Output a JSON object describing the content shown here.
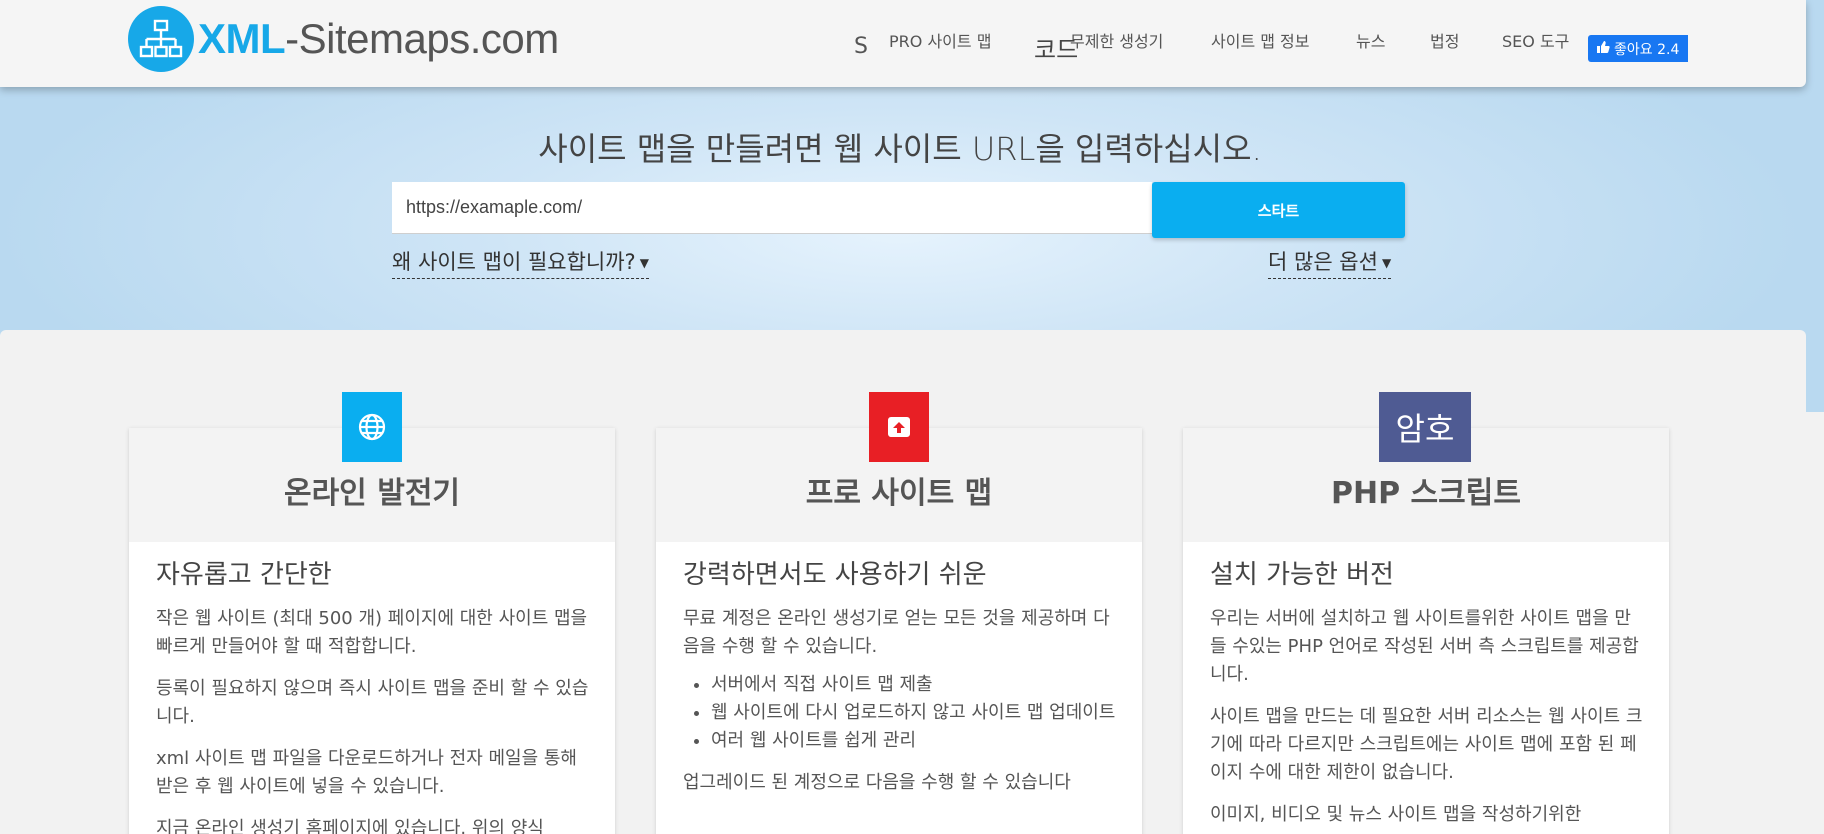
{
  "header": {
    "logo_xml": "XML",
    "logo_rest": "-Sitemaps.com",
    "nav_s": "S",
    "nav_code": "코드",
    "nav_items": [
      {
        "label": "PRO 사이트 맵"
      },
      {
        "label": "무제한 생성기"
      },
      {
        "label": "사이트 맵 정보"
      },
      {
        "label": "뉴스"
      },
      {
        "label": "법정"
      },
      {
        "label": "SEO 도구"
      }
    ],
    "fb_like": "좋아요 2.4"
  },
  "hero": {
    "title": "사이트 맵을 만들려면 웹 사이트 URL을 입력하십시오.",
    "url_value": "https://examaple.com/",
    "start_label": "스타트",
    "why_link": "왜 사이트 맵이 필요합니까?",
    "more_options": "더 많은 옵션"
  },
  "cards": [
    {
      "icon": "globe-icon",
      "icon_color": "#0aaef0",
      "title": "온라인 발전기",
      "subtitle": "자유롭고 간단한",
      "paragraphs": [
        "작은 웹 사이트 (최대 500 개) 페이지에 대한 사이트 맵을 빠르게 만들어야 할 때 적합합니다.",
        "등록이 필요하지 않으며 즉시 사이트 맵을 준비 할 수 있습니다.",
        "xml 사이트 맵 파일을 다운로드하거나 전자 메일을 통해받은 후 웹 사이트에 넣을 수 있습니다.",
        "지금 온라인 생성기 홈페이지에 있습니다. 위의 양식"
      ]
    },
    {
      "icon": "upload-box-icon",
      "icon_color": "#e81f25",
      "title": "프로 사이트 맵",
      "subtitle": "강력하면서도 사용하기 쉬운",
      "paragraphs": [
        "무료 계정은 온라인 생성기로 얻는 모든 것을 제공하며 다음을 수행 할 수 있습니다."
      ],
      "list": [
        "서버에서 직접 사이트 맵 제출",
        "웹 사이트에 다시 업로드하지 않고 사이트 맵 업데이트",
        "여러 웹 사이트를 쉽게 관리"
      ],
      "after": "업그레이드 된 계정으로 다음을 수행 할 수 있습니다"
    },
    {
      "icon_text": "암호",
      "icon_color": "#4f5b93",
      "title": "PHP 스크립트",
      "subtitle": "설치 가능한 버전",
      "paragraphs": [
        "우리는 서버에 설치하고 웹 사이트를위한 사이트 맵을 만들 수있는 PHP 언어로 작성된 서버 측 스크립트를 제공합니다.",
        "사이트 맵을 만드는 데 필요한 서버 리소스는 웹 사이트 크기에 따라 다르지만 스크립트에는 사이트 맵에 포함 된 페이지 수에 대한 제한이 없습니다.",
        "이미지, 비디오 및 뉴스 사이트 맵을 작성하기위한"
      ]
    }
  ]
}
